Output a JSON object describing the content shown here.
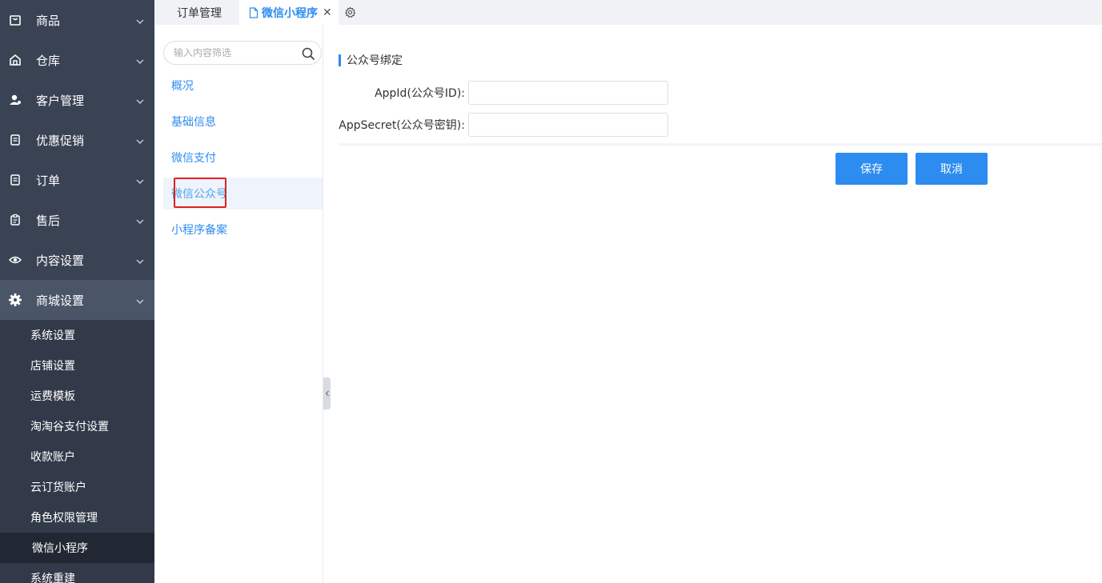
{
  "sidebar": {
    "items": [
      {
        "label": "商品",
        "icon": "bag-icon"
      },
      {
        "label": "仓库",
        "icon": "warehouse-icon"
      },
      {
        "label": "客户管理",
        "icon": "user-icon"
      },
      {
        "label": "优惠促销",
        "icon": "list-icon"
      },
      {
        "label": "订单",
        "icon": "list-icon"
      },
      {
        "label": "售后",
        "icon": "clipboard-icon"
      },
      {
        "label": "内容设置",
        "icon": "eye-icon"
      },
      {
        "label": "商城设置",
        "icon": "gear-icon"
      }
    ],
    "subitems": [
      "系统设置",
      "店铺设置",
      "运费模板",
      "淘淘谷支付设置",
      "收款账户",
      "云订货账户",
      "角色权限管理",
      "微信小程序",
      "系统重建"
    ],
    "active_subitem": "微信小程序"
  },
  "tabs": {
    "items": [
      {
        "label": "订单管理"
      },
      {
        "label": "微信小程序",
        "active": true
      }
    ],
    "close_symbol": "✕"
  },
  "subpanel": {
    "search_placeholder": "输入内容筛选",
    "nav": [
      "概况",
      "基础信息",
      "微信支付",
      "微信公众号",
      "小程序备案"
    ],
    "active_nav": "微信公众号"
  },
  "main": {
    "section_title": "公众号绑定",
    "fields": [
      {
        "label": "AppId(公众号ID):",
        "value": ""
      },
      {
        "label": "AppSecret(公众号密钥):",
        "value": ""
      }
    ],
    "save_label": "保存",
    "cancel_label": "取消"
  },
  "colors": {
    "sidebar_bg": "#3a4354",
    "accent": "#2d8cf0",
    "highlight": "#e02020"
  }
}
